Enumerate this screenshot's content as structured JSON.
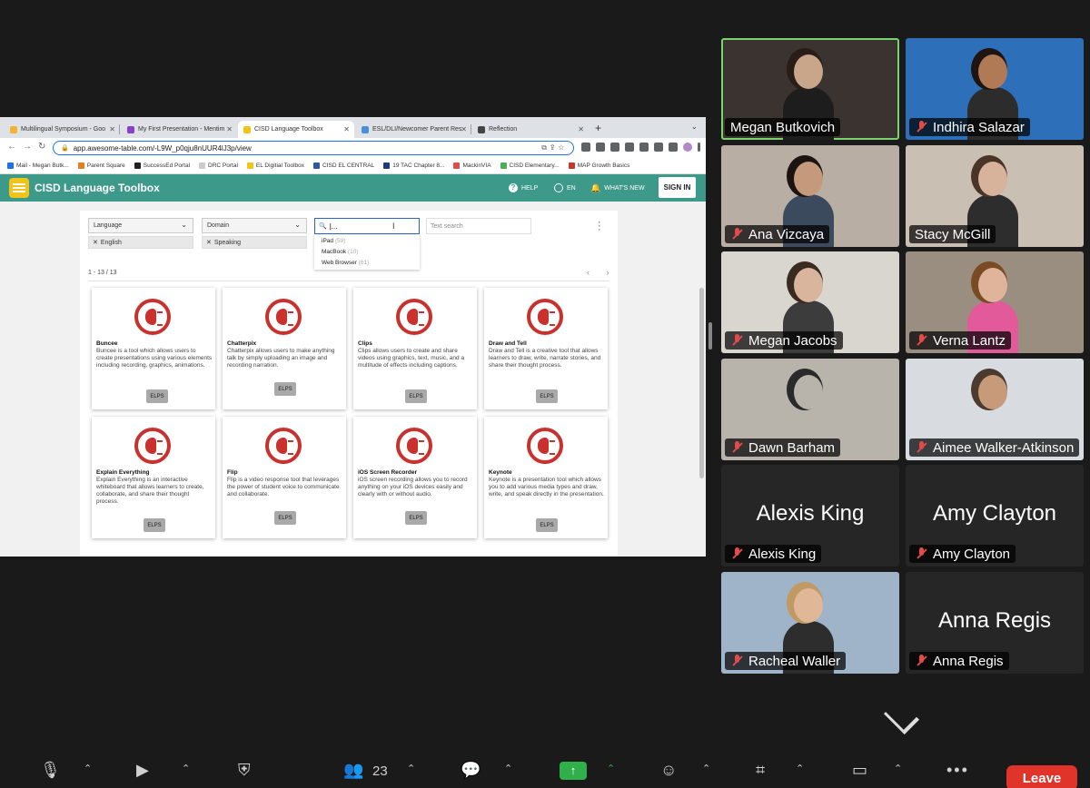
{
  "browser": {
    "tabs": [
      {
        "label": "Multilingual Symposium - Goo",
        "fav": "#f2b233",
        "active": false
      },
      {
        "label": "My First Presentation - Mentim",
        "fav": "#8c3fc8",
        "active": false
      },
      {
        "label": "CISD Language Toolbox",
        "fav": "#f0c419",
        "active": true
      },
      {
        "label": "ESL/DLI/Newcomer Parent Res",
        "fav": "#4a90d9",
        "active": false
      },
      {
        "label": "Reflection",
        "fav": "#444444",
        "active": false
      }
    ],
    "new_tab": "+",
    "url": "app.awesome-table.com/-L9W_p0qju8nUUR4lJ3p/view",
    "bookmarks": [
      {
        "label": "Mail - Megan Butk...",
        "fav": "#1a73e8"
      },
      {
        "label": "Parent Square",
        "fav": "#e67e22"
      },
      {
        "label": "SuccessEd Portal",
        "fav": "#222222"
      },
      {
        "label": "DRC Portal",
        "fav": "#cccccc"
      },
      {
        "label": "EL Digitial Toolbox",
        "fav": "#f0c419"
      },
      {
        "label": "CISD EL CENTRAL",
        "fav": "#2c5aa0"
      },
      {
        "label": "19 TAC Chapter 8...",
        "fav": "#1f3a7a"
      },
      {
        "label": "MackinVIA",
        "fav": "#e24b4b"
      },
      {
        "label": "CISD Elementary...",
        "fav": "#4caf50"
      },
      {
        "label": "MAP Growth Basics",
        "fav": "#c0392b"
      }
    ]
  },
  "app": {
    "title": "CISD Language Toolbox",
    "help": "HELP",
    "lang": "EN",
    "whats_new": "WHAT'S NEW",
    "sign_in": "SIGN IN",
    "filters": {
      "language": {
        "label": "Language",
        "chip": "English"
      },
      "domain": {
        "label": "Domain",
        "chip": "Speaking"
      },
      "device_input_value": "|...",
      "device_options": [
        {
          "label": "iPad",
          "count": "(59)"
        },
        {
          "label": "MacBook",
          "count": "(10)"
        },
        {
          "label": "Web Browser",
          "count": "(61)"
        }
      ],
      "text_search_placeholder": "Text search"
    },
    "results_count": "1 - 13 / 13",
    "pager": "‹ ›",
    "cards": [
      {
        "name": "Buncee",
        "desc": "Buncee is a tool which allows users to create presentations using various elements including recording, graphics, animations.",
        "tag": "ELPS"
      },
      {
        "name": "Chatterpix",
        "desc": "Chatterpix allows users to make anything talk by simply uploading an image and recording narration.",
        "tag": "ELPS"
      },
      {
        "name": "Clips",
        "desc": "Clips allows users to create and share videos using graphics, text, music, and a multitude of effects including captions.",
        "tag": "ELPS"
      },
      {
        "name": "Draw and Tell",
        "desc": "Draw and Tell is a creative tool that allows learners to draw, write, narrate stories, and share their thought process.",
        "tag": "ELPS"
      },
      {
        "name": "Explain Everything",
        "desc": "Explain Everything is an interactive whiteboard that allows learners to create, collaborate, and share their thought process.",
        "tag": "ELPS"
      },
      {
        "name": "Flip",
        "desc": "Flip is a video response tool that leverages the power of student voice to communicate and collaborate.",
        "tag": "ELPS"
      },
      {
        "name": "iOS Screen Recorder",
        "desc": "iOS screen recording allows you to record anything on your iOS devices easily and clearly with or without audio.",
        "tag": "ELPS"
      },
      {
        "name": "Keynote",
        "desc": "Keynote is a presentation tool which allows you to add various media types and draw, write, and speak directly in the presentation.",
        "tag": "ELPS"
      }
    ]
  },
  "participants": [
    {
      "name": "Megan Butkovich",
      "muted": false,
      "video": true,
      "bg": "#3b3330",
      "skin": "#c9a58a",
      "hair": "#2a1c16",
      "shirt": "#1d1d1d",
      "speaking": true
    },
    {
      "name": "Indhira Salazar",
      "muted": true,
      "video": true,
      "bg": "#2d6fb8",
      "skin": "#b07a56",
      "hair": "#1e1410",
      "shirt": "#2c2c2c",
      "speaking": false
    },
    {
      "name": "Ana Vizcaya",
      "muted": true,
      "video": true,
      "bg": "#b9aea4",
      "skin": "#c59a7c",
      "hair": "#1c1410",
      "shirt": "#3b4a5c",
      "speaking": false
    },
    {
      "name": "Stacy McGill",
      "muted": false,
      "video": true,
      "bg": "#c9bfb2",
      "skin": "#d6b39a",
      "hair": "#4a3428",
      "shirt": "#2d2d2d",
      "speaking": false
    },
    {
      "name": "Megan Jacobs",
      "muted": true,
      "video": true,
      "bg": "#d9d6d0",
      "skin": "#d8b59c",
      "hair": "#3a2a20",
      "shirt": "#3c3c3c",
      "speaking": false
    },
    {
      "name": "Verna Lantz",
      "muted": true,
      "video": true,
      "bg": "#9a8e80",
      "skin": "#e0b49a",
      "hair": "#7a4a24",
      "shirt": "#e35a9a",
      "speaking": false
    },
    {
      "name": "Dawn Barham",
      "muted": true,
      "video": true,
      "bg": "#b8b3ab",
      "skin": "#b8b3ab",
      "hair": "#2a2a2a",
      "shirt": "#b8b3ab",
      "speaking": false
    },
    {
      "name": "Aimee Walker-Atkinson",
      "muted": true,
      "video": true,
      "bg": "#d8dce0",
      "skin": "#c79a7a",
      "hair": "#4a3a30",
      "shirt": "#d8dce0",
      "speaking": false
    },
    {
      "name": "Alexis King",
      "muted": true,
      "video": false,
      "big": "Alexis King",
      "speaking": false
    },
    {
      "name": "Amy Clayton",
      "muted": true,
      "video": false,
      "big": "Amy Clayton",
      "speaking": false
    },
    {
      "name": "Racheal Waller",
      "muted": true,
      "video": true,
      "bg": "#9fb4c8",
      "skin": "#e0b898",
      "hair": "#c09a62",
      "shirt": "#2d2d2d",
      "speaking": false
    },
    {
      "name": "Anna Regis",
      "muted": true,
      "video": false,
      "big": "Anna Regis",
      "speaking": false
    }
  ],
  "toolbar": {
    "participant_count": "23",
    "leave": "Leave"
  }
}
